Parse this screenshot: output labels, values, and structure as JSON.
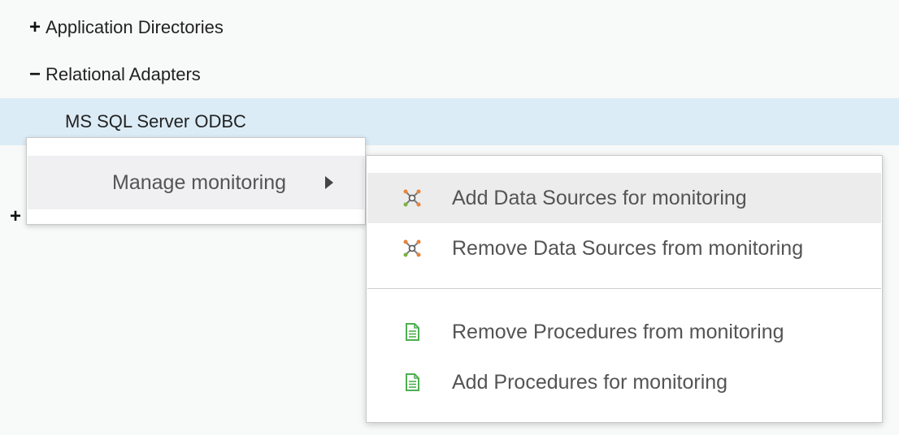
{
  "tree": {
    "items": [
      {
        "toggle": "+",
        "label": "Application Directories"
      },
      {
        "toggle": "−",
        "label": "Relational Adapters"
      },
      {
        "toggle": "",
        "label": "MS SQL Server ODBC"
      },
      {
        "toggle": "+",
        "label": ""
      }
    ]
  },
  "context_menu": {
    "items": [
      {
        "label": "Manage monitoring",
        "has_submenu": true
      }
    ]
  },
  "submenu": {
    "items": [
      {
        "label": "Add Data Sources for monitoring",
        "icon": "data-source-icon"
      },
      {
        "label": "Remove Data Sources from monitoring",
        "icon": "data-source-icon"
      },
      {
        "label": "Remove Procedures from monitoring",
        "icon": "procedure-document-icon"
      },
      {
        "label": "Add Procedures for monitoring",
        "icon": "procedure-document-icon"
      }
    ]
  },
  "colors": {
    "selected_row": "#dcecf6",
    "menu_hover": "#ececec",
    "doc_icon_green": "#4caf50",
    "ds_icon_orange": "#e8833a",
    "ds_icon_green": "#7cb342"
  }
}
